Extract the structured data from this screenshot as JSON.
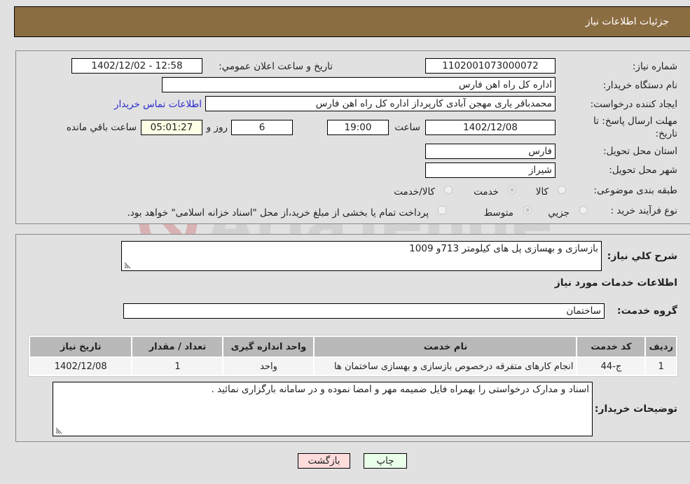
{
  "header": {
    "title": "جزئیات اطلاعات نیاز"
  },
  "form": {
    "need_number": {
      "label": "شماره نیاز:",
      "value": "1102001073000072"
    },
    "announce_datetime": {
      "label": "تاریخ و ساعت اعلان عمومي:",
      "value": "1402/12/02 - 12:58"
    },
    "buyer_org": {
      "label": "نام دستگاه خریدار:",
      "value": "اداره کل راه اهن فارس"
    },
    "requester": {
      "label": "ایجاد کننده درخواست:",
      "value": "محمدباقر یاری مهجن آبادی کارپرداز اداره کل راه اهن فارس",
      "contact_link": "اطلاعات تماس خریدار"
    },
    "deadline": {
      "label_line1": "مهلت ارسال پاسخ: تا",
      "label_line2": "تاریخ:",
      "date": "1402/12/08",
      "time_label": "ساعت",
      "time": "19:00",
      "days": "6",
      "days_label": "روز و",
      "remaining": "05:01:27",
      "remaining_label": "ساعت باقي مانده"
    },
    "province": {
      "label": "استان محل تحویل:",
      "value": "فارس"
    },
    "city": {
      "label": "شهر محل تحویل:",
      "value": "شیراز"
    },
    "category": {
      "label": "طبقه بندی موضوعی:",
      "options": [
        {
          "label": "کالا",
          "checked": false
        },
        {
          "label": "خدمت",
          "checked": true
        },
        {
          "label": "کالا/خدمت",
          "checked": false
        }
      ]
    },
    "purchase_type": {
      "label": "نوع فرآیند خرید :",
      "options": [
        {
          "label": "جزيي",
          "checked": false
        },
        {
          "label": "متوسط",
          "checked": true
        }
      ],
      "treasury_note": "پرداخت تمام یا بخشی از مبلغ خرید،از محل \"اسناد خزانه اسلامی\" خواهد بود.",
      "treasury_checked": false
    }
  },
  "details": {
    "description_label": "شرح کلي نیاز:",
    "description": "بازسازی و بهسازی پل های کیلومتر 713و 1009",
    "services_heading": "اطلاعات خدمات مورد نیاز",
    "service_group_label": "گروه خدمت:",
    "service_group": "ساختمان",
    "table": {
      "headers": [
        "ردیف",
        "کد خدمت",
        "نام خدمت",
        "واحد اندازه گیری",
        "تعداد / مقدار",
        "تاریخ نیاز"
      ],
      "rows": [
        [
          "1",
          "ج-44",
          "انجام کارهای متفرقه درخصوص بازسازی و بهسازی ساختمان ها",
          "واحد",
          "1",
          "1402/12/08"
        ]
      ]
    },
    "buyer_notes_label": "توضیحات خریدار:",
    "buyer_notes": "اسناد و مدارک درخواستی را بهمراه فایل ضمیمه مهر و امضا نموده و در سامانه بارگزاری نمائید ."
  },
  "buttons": {
    "print": "چاپ",
    "back": "بازگشت"
  },
  "watermark": {
    "text": "AriaTender.neT"
  },
  "colors": {
    "header_bg": "#8b6d42",
    "print_bg": "#eaffea",
    "back_bg": "#ffdcdc",
    "link": "#2a2ad0"
  }
}
